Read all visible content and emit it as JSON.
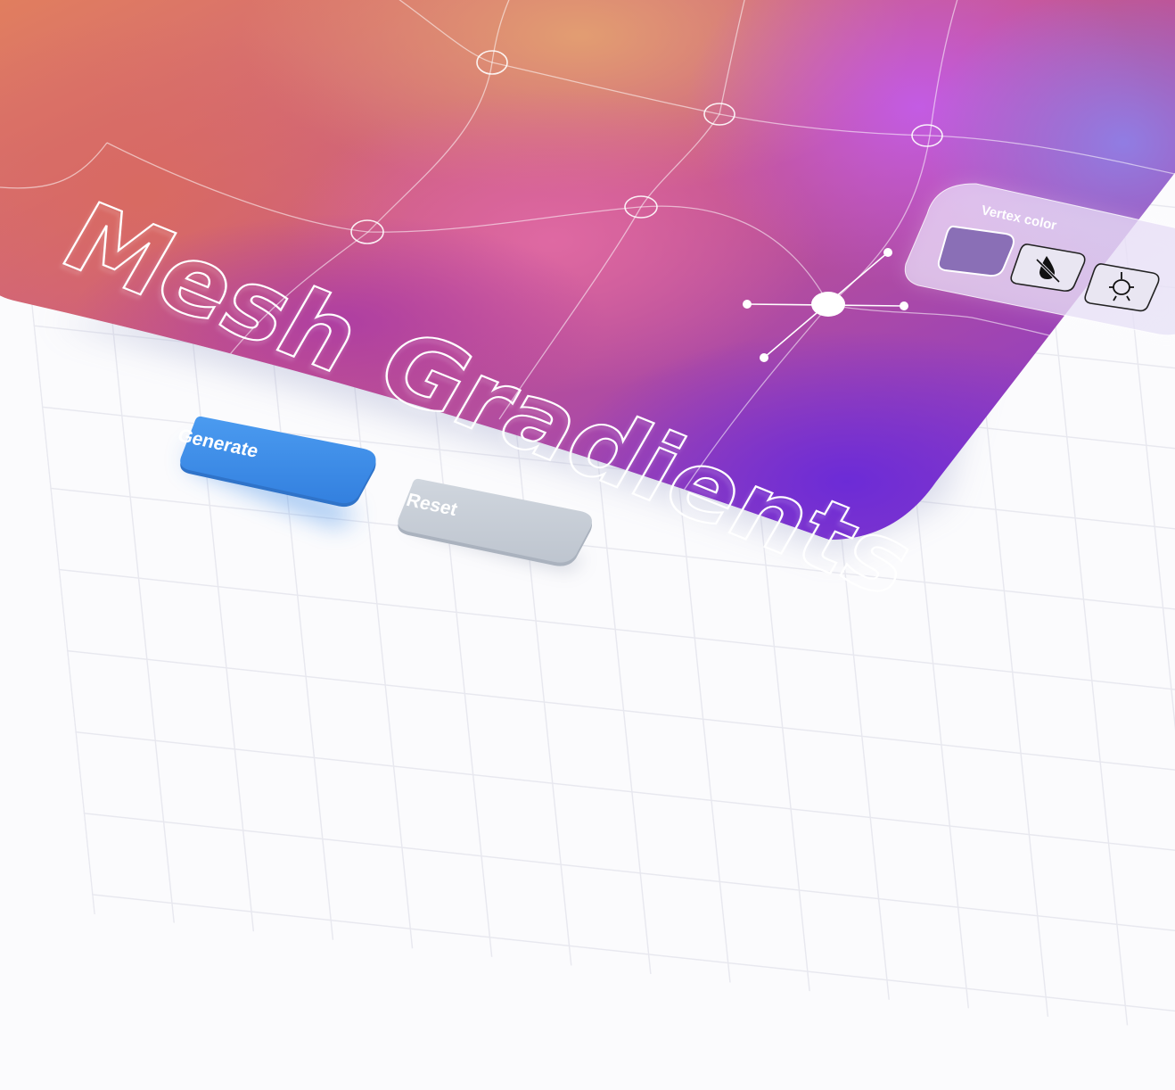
{
  "hero": {
    "title": "Mesh Gradients"
  },
  "vertex_panel": {
    "title": "Vertex color",
    "swatch_color": "#8a6fb6",
    "tools": [
      {
        "icon": "color-drop-off-icon"
      },
      {
        "icon": "spread-tool-icon"
      }
    ]
  },
  "actions": {
    "generate_label": "Generate",
    "reset_label": "Reset"
  },
  "colors": {
    "accent": "#3d8ae6",
    "mesh_orange": "#e2805c",
    "mesh_pink": "#d25a98",
    "mesh_purple": "#7733db",
    "mesh_violet": "#b95be0",
    "reset_gray": "#c6ccd6"
  }
}
